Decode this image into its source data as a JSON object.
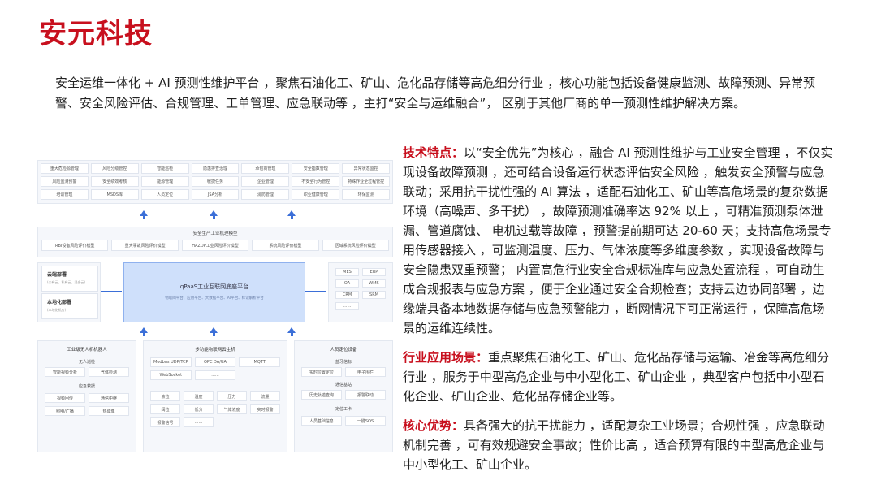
{
  "page": {
    "title": "安元科技",
    "intro": "安全运维一体化 + AI 预测性维护平台 ，聚焦石油化工、矿山、危化品存储等高危细分行业 ，核心功能包括设备健康监测、故障预测、异常预警、安全风险评估、合规管理、工单管理、应急联动等 ，主打“安全与运维融合”， 区别于其他厂商的单一预测性维护解决方案。"
  },
  "sections": [
    {
      "label": "技术特点：",
      "text": "以“安全优先”为核心 ，融合 AI 预测性维护与工业安全管理 ，不仅实现设备故障预测 ，还可结合设备运行状态评估安全风险 ，触发安全预警与应急联动；采用抗干扰性强的 AI 算法 ，适配石油化工、矿山等高危场景的复杂数据环境（高噪声、多干扰） ，故障预测准确率达 92% 以上 ，可精准预测泵体泄漏、管道腐蚀、 电机过载等故障 ，预警提前期可达 20-60 天；支持高危场景专用传感器接入 ，可监测温度、压力、气体浓度等多维度参数 ，实现设备故障与安全隐患双重预警； 内置高危行业安全合规标准库与应急处置流程 ，可自动生成合规报表与应急方案 ，便于企业通过安全合规检查；支持云边协同部署 ，边缘端具备本地数据存储与应急预警能力 ，断网情况下可正常运行 ，保障高危场景的运维连续性。"
    },
    {
      "label": "行业应用场景：",
      "text": "重点聚焦石油化工、矿山、危化品存储与运输、冶金等高危细分行业 ，服务于中型高危企业与中小型化工、矿山企业 ，典型客户包括中小型石化企业、矿山企业、危化品存储企业等。"
    },
    {
      "label": "核心优势：",
      "text": "具备强大的抗干扰能力 ，适配复杂工业场景；合规性强 ，应急联动机制完善 ，可有效规避安全事故；性价比高 ，适合预算有限的中型高危企业与中小型化工、矿山企业。"
    }
  ],
  "diagram": {
    "top_grid": [
      "重大危险源管理",
      "风险分级管控",
      "智能巡检",
      "隐患排查治理",
      "承包商管理",
      "安全指数管理",
      "异常状态监控",
      "风险监测预警",
      "安全绩效考核",
      "能源管理",
      "敏捷任务",
      "企业管理",
      "不安全行为管控",
      "特殊作业全过程管控",
      "培训管理",
      "MSDS库",
      "人员定位",
      "JSA分析",
      "消防管理",
      "职业健康管理",
      "环保监测"
    ],
    "model_title": "安全生产工业机理模型",
    "model_items": [
      "RBI设备风险评价模型",
      "重大事故风险评价模型",
      "HAZOP工业风险评价模型",
      "系统风险评价模型",
      "区域系统风险评价模型"
    ],
    "cloud": {
      "label": "云端部署",
      "sub": "(公有云、私有云、混合云)"
    },
    "local": {
      "label": "本地化部署",
      "sub": "(本地化机房)"
    },
    "platform_title": "qPaaS工业互联网底座平台",
    "platform_sub": "物联网平台、应用平台、大数据平台、AI平台、标识解析平台",
    "right_items": [
      "MES",
      "ERP",
      "OA",
      "WMS",
      "CRM",
      "SRM",
      "......"
    ],
    "robot": {
      "title": "工业级无人机机器人",
      "sub1": "无人巡检",
      "row1": [
        "智能视频分析",
        "气体检测"
      ],
      "sub2": "应急救援",
      "row2": [
        "视频回传",
        "通信中继"
      ],
      "row3": [
        "照明/广播",
        "热成像"
      ]
    },
    "gateway": {
      "title": "多功能物联网云主机",
      "protocols": [
        "Modbus UDP/TCP",
        "OPC DA/UA",
        "MQTT"
      ],
      "protocols2": [
        "WebSocket",
        "......"
      ],
      "row1": [
        "液位",
        "温度",
        "压力",
        "流量"
      ],
      "row2": [
        "阀位",
        "低分",
        "气体浓度",
        "实时报警"
      ],
      "row3": [
        "报警信号",
        "......"
      ]
    },
    "locate": {
      "title": "人员定位设备",
      "sub1": "蓝牙信标",
      "row1": [
        "实时位置定位",
        "电子围栏"
      ],
      "sub2": "通信基站",
      "row2": [
        "历史轨迹查询",
        "报警联动"
      ],
      "sub3": "定位工卡",
      "row3": [
        "人员基础信息",
        "一键SOS"
      ]
    }
  }
}
